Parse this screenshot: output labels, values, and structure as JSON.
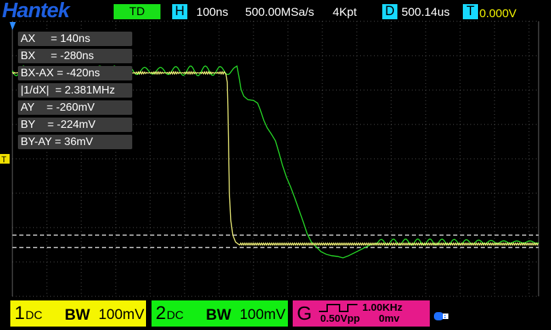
{
  "topbar": {
    "logo": "Hantek",
    "mode": "TD",
    "horizontal_letter": "H",
    "timebase": "100ns",
    "sample_rate": "500.00MSa/s",
    "memory_depth": "4Kpt",
    "delay_letter": "D",
    "delay": "500.14us",
    "trigger_letter": "T",
    "trigger_level": "0.000V"
  },
  "markers": {
    "trigger_marker": "T"
  },
  "cursor_readouts": [
    "AX     = 140ns",
    "BX     = -280ns",
    "BX-AX = -420ns",
    "|1/dX|  = 2.381MHz",
    "AY    = -260mV",
    "BY    = -224mV",
    "BY-AY = 36mV"
  ],
  "channels": [
    {
      "number": "1",
      "coupling": "DC",
      "bw": "BW",
      "scale": "100mV",
      "color": "#f5f500"
    },
    {
      "number": "2",
      "coupling": "DC",
      "bw": "BW",
      "scale": "100mV",
      "color": "#12ee12"
    }
  ],
  "generator": {
    "label": "G",
    "waveform_icon": "square-wave-icon",
    "frequency": "1.00KHz",
    "amplitude": "0.50Vpp",
    "offset": "0mv",
    "color": "#e61a8a"
  },
  "status": {
    "usb_icon": "usb-icon"
  },
  "colors": {
    "logo": "#1e5fe0",
    "accent": "#17d9ff",
    "ch1": "#f5f500",
    "ch2": "#12ee12"
  }
}
